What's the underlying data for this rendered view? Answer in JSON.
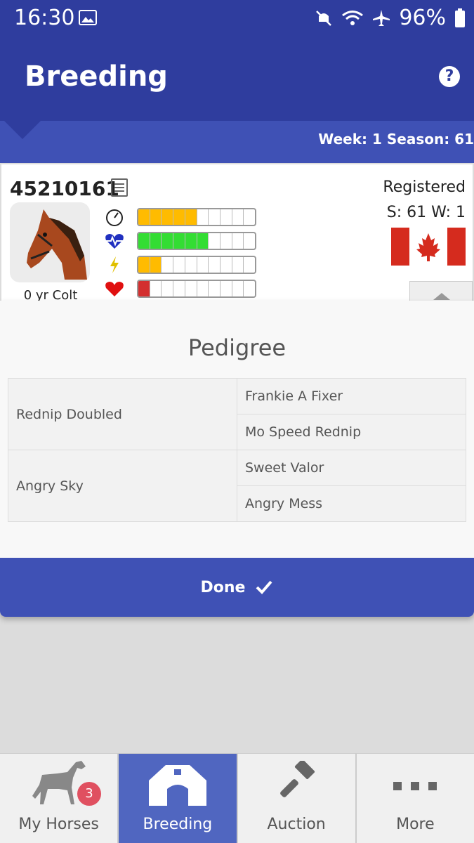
{
  "status": {
    "time": "16:30",
    "battery": "96%"
  },
  "app": {
    "title": "Breeding"
  },
  "week_bar": {
    "text": "Week: 1  Season: 61"
  },
  "horse": {
    "id": "45210161",
    "age_sex": "0 yr Colt",
    "registered_label": "Registered",
    "season_week": "S: 61 W: 1",
    "stats": [
      {
        "icon": "speedometer-icon",
        "fraction": 0.45,
        "color": "#ffbb00"
      },
      {
        "icon": "heartbeat-icon",
        "fraction": 0.6,
        "color": "#33dd33"
      },
      {
        "icon": "lightning-icon",
        "fraction": 0.22,
        "color": "#ffbb00"
      },
      {
        "icon": "heart-icon",
        "fraction": 0.12,
        "color": "#d32f2f"
      }
    ]
  },
  "pedigree": {
    "title": "Pedigree",
    "sire": "Rednip Doubled",
    "sire_sire": "Frankie A Fixer",
    "sire_dam": "Mo Speed Rednip",
    "dam": "Angry Sky",
    "dam_sire": "Sweet Valor",
    "dam_dam": "Angry Mess"
  },
  "done_label": "Done",
  "nav": {
    "items": [
      {
        "label": "My Horses",
        "icon": "horse-icon",
        "badge": "3"
      },
      {
        "label": "Breeding",
        "icon": "barn-icon"
      },
      {
        "label": "Auction",
        "icon": "gavel-icon"
      },
      {
        "label": "More",
        "icon": "more-dots-icon"
      }
    ]
  },
  "colors": {
    "primary": "#2f3d9e",
    "accent": "#3f51b5",
    "nav_active": "#5066c0"
  }
}
